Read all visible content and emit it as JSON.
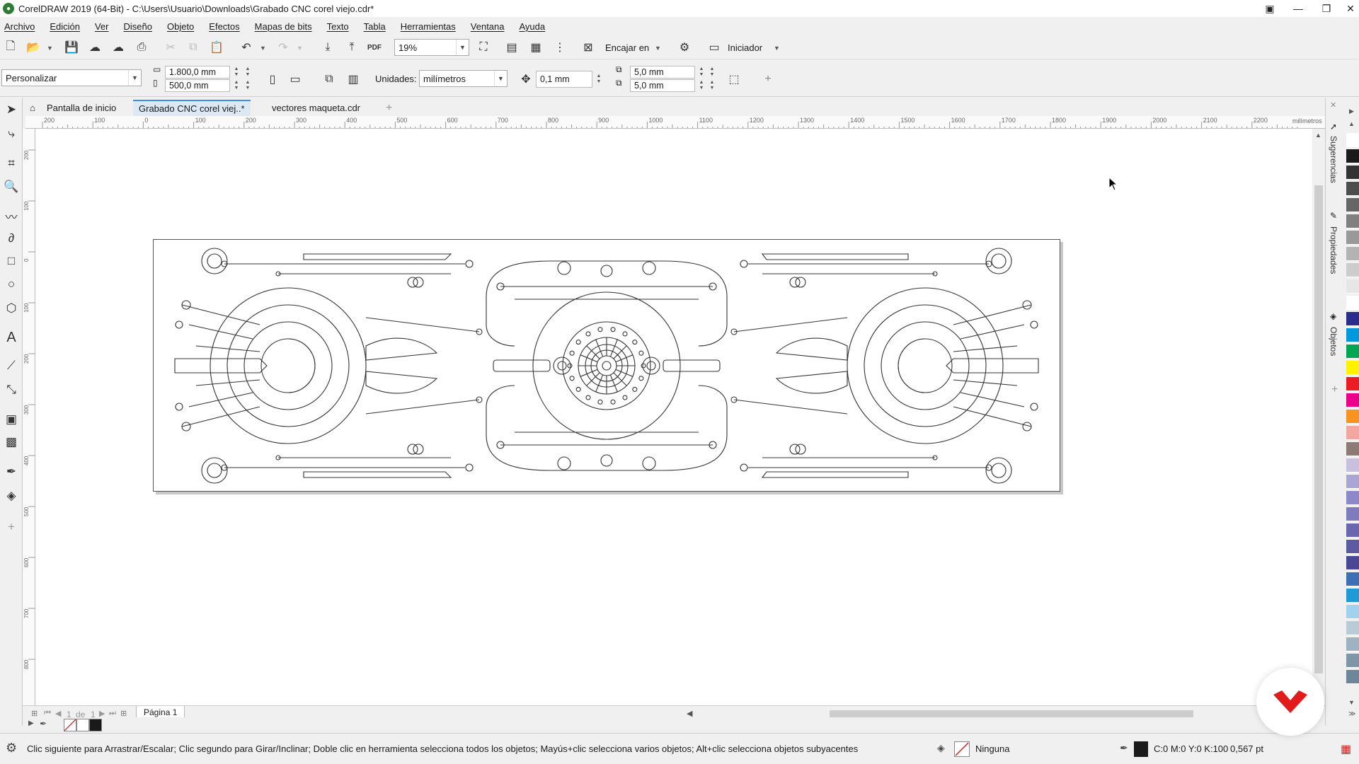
{
  "window": {
    "title": "CorelDRAW 2019 (64-Bit) - C:\\Users\\Usuario\\Downloads\\Grabado CNC corel viejo.cdr*",
    "controls": [
      "minimize",
      "maximize",
      "close"
    ]
  },
  "menu": [
    "Archivo",
    "Edición",
    "Ver",
    "Diseño",
    "Objeto",
    "Efectos",
    "Mapas de bits",
    "Texto",
    "Tabla",
    "Herramientas",
    "Ventana",
    "Ayuda"
  ],
  "standard_toolbar": {
    "zoom": "19%",
    "snap_label": "Encajar en",
    "launcher_label": "Iniciador",
    "pdf_label": "PDF"
  },
  "property_bar": {
    "preset": "Personalizar",
    "width": "1.800,0 mm",
    "height": "500,0 mm",
    "units_label": "Unidades:",
    "units_value": "milímetros",
    "nudge": "0,1 mm",
    "dup_x": "5,0 mm",
    "dup_y": "5,0 mm"
  },
  "doc_tabs": [
    {
      "label": "Pantalla de inicio",
      "active": false
    },
    {
      "label": "Grabado CNC corel viej..*",
      "active": true
    },
    {
      "label": "vectores maqueta.cdr",
      "active": false
    }
  ],
  "ruler": {
    "ticks": [
      "200",
      "100",
      "0",
      "100",
      "200",
      "300",
      "400",
      "500",
      "600",
      "700",
      "800",
      "900",
      "1000",
      "1100",
      "1200",
      "1300",
      "1400",
      "1500",
      "1600",
      "1700",
      "1800",
      "1900",
      "2000",
      "2100",
      "2200"
    ],
    "unit": "milímetros",
    "v_ticks": [
      "200",
      "100",
      "0",
      "100",
      "200",
      "300",
      "400",
      "500",
      "600",
      "700",
      "800",
      "900",
      "1000"
    ]
  },
  "dockers": [
    "Sugerencias",
    "Propiedades",
    "Objetos"
  ],
  "page_nav": {
    "current": "1",
    "of_label": "de",
    "total": "1",
    "page_tab": "Página 1"
  },
  "status": {
    "hint": "Clic siguiente para Arrastrar/Escalar; Clic segundo para Girar/Inclinar; Doble clic en herramienta selecciona todos los objetos; Mayús+clic selecciona varios objetos; Alt+clic selecciona objetos subyacentes",
    "fill": "Ninguna",
    "outline_color": "C:0 M:0 Y:0 K:100",
    "outline_width": "0,567 pt"
  },
  "palette_colors": [
    "#ffffff",
    "#1a1a1a",
    "#333333",
    "#4d4d4d",
    "#666666",
    "#808080",
    "#999999",
    "#b3b3b3",
    "#cccccc",
    "#e6e6e6",
    "#ffffff",
    "#2b2d8e",
    "#0099dd",
    "#00a651",
    "#fff200",
    "#ed1c24",
    "#ec008c",
    "#f7931e",
    "#f4a6a0",
    "#8c7b75",
    "#c9c0e0",
    "#a9a6d6",
    "#8c88c9",
    "#7e7bbf",
    "#6a67b0",
    "#5d5aa3",
    "#4a4894",
    "#3c6fb5",
    "#1e9bd7",
    "#a0d2ef",
    "#b8cbd6",
    "#9fb2c2",
    "#7f96a8",
    "#6d8699"
  ],
  "colors": {
    "accent": "#3b8fd8",
    "badge_red": "#e21b1b"
  }
}
